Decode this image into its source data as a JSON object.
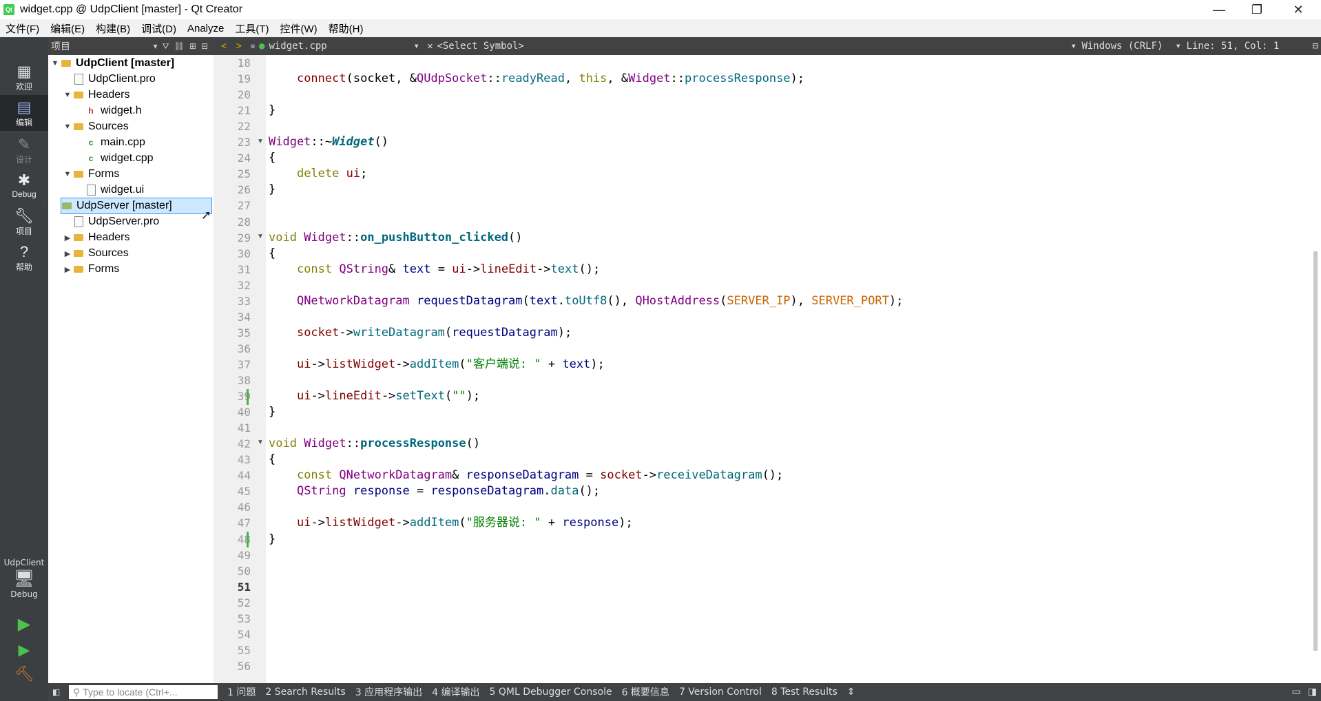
{
  "window": {
    "title": "widget.cpp @ UdpClient [master] - Qt Creator"
  },
  "menu": [
    "文件(F)",
    "编辑(E)",
    "构建(B)",
    "调试(D)",
    "Analyze",
    "工具(T)",
    "控件(W)",
    "帮助(H)"
  ],
  "modes": {
    "welcome": "欢迎",
    "edit": "编辑",
    "design": "设计",
    "debug": "Debug",
    "project": "项目",
    "help": "帮助"
  },
  "kit": {
    "project": "UdpClient",
    "config": "Debug"
  },
  "project_panel": {
    "title": "项目"
  },
  "tree": [
    {
      "label": "UdpClient [master]"
    },
    {
      "label": "UdpClient.pro"
    },
    {
      "label": "Headers"
    },
    {
      "label": "widget.h"
    },
    {
      "label": "Sources"
    },
    {
      "label": "main.cpp"
    },
    {
      "label": "widget.cpp"
    },
    {
      "label": "Forms"
    },
    {
      "label": "widget.ui"
    },
    {
      "label": "UdpServer [master]"
    },
    {
      "label": "UdpServer.pro"
    },
    {
      "label": "Headers"
    },
    {
      "label": "Sources"
    },
    {
      "label": "Forms"
    }
  ],
  "editor": {
    "file": "widget.cpp",
    "symbol": "<Select Symbol>",
    "line_ending": "Windows (CRLF)",
    "position": "Line: 51, Col: 1"
  },
  "line_numbers": [
    "18",
    "19",
    "20",
    "21",
    "22",
    "23",
    "24",
    "25",
    "26",
    "27",
    "28",
    "29",
    "30",
    "31",
    "32",
    "33",
    "34",
    "35",
    "36",
    "37",
    "38",
    "39",
    "40",
    "41",
    "42",
    "43",
    "44",
    "45",
    "46",
    "47",
    "48",
    "49",
    "50",
    "51",
    "52",
    "53",
    "54",
    "55",
    "56"
  ],
  "code": {
    "l19": [
      [
        "    ",
        ""
      ],
      [
        "connect",
        "#800000"
      ],
      [
        "(",
        "#000"
      ],
      [
        "socket",
        "#000"
      ],
      [
        ", &",
        "#000"
      ],
      [
        "QUdpSocket",
        "#800080"
      ],
      [
        "::",
        "#000"
      ],
      [
        "readyRead",
        "#00677c"
      ],
      [
        ", ",
        "#000"
      ],
      [
        "this",
        "#808000"
      ],
      [
        ", &",
        "#000"
      ],
      [
        "Widget",
        "#800080"
      ],
      [
        "::",
        "#000"
      ],
      [
        "processResponse",
        "#00677c"
      ],
      [
        ");",
        "#000"
      ]
    ],
    "l21": [
      [
        "}",
        "#000"
      ]
    ],
    "l23": [
      [
        "Widget",
        "#800080"
      ],
      [
        "::~",
        "#000"
      ],
      [
        "Widget",
        "#00677c"
      ],
      [
        "()",
        "#000"
      ]
    ],
    "l24": [
      [
        "{",
        "#000"
      ]
    ],
    "l25": [
      [
        "    ",
        ""
      ],
      [
        "delete",
        "#808000"
      ],
      [
        " ",
        "#000"
      ],
      [
        "ui",
        "#800000"
      ],
      [
        ";",
        "#000"
      ]
    ],
    "l26": [
      [
        "}",
        "#000"
      ]
    ],
    "l29": [
      [
        "void",
        "#808000"
      ],
      [
        " ",
        "#000"
      ],
      [
        "Widget",
        "#800080"
      ],
      [
        "::",
        "#000"
      ],
      [
        "on_pushButton_clicked",
        "#00677c"
      ],
      [
        "()",
        "#000"
      ]
    ],
    "l30": [
      [
        "{",
        "#000"
      ]
    ],
    "l31": [
      [
        "    ",
        ""
      ],
      [
        "const",
        "#808000"
      ],
      [
        " ",
        "#000"
      ],
      [
        "QString",
        "#800080"
      ],
      [
        "& ",
        "#000"
      ],
      [
        "text",
        "#000080"
      ],
      [
        " = ",
        "#000"
      ],
      [
        "ui",
        "#800000"
      ],
      [
        "->",
        "#000"
      ],
      [
        "lineEdit",
        "#800000"
      ],
      [
        "->",
        "#000"
      ],
      [
        "text",
        "#00677c"
      ],
      [
        "();",
        "#000"
      ]
    ],
    "l33": [
      [
        "    ",
        ""
      ],
      [
        "QNetworkDatagram",
        "#800080"
      ],
      [
        " ",
        "#000"
      ],
      [
        "requestDatagram",
        "#000080"
      ],
      [
        "(",
        "#000"
      ],
      [
        "text",
        "#000080"
      ],
      [
        ".",
        "#000"
      ],
      [
        "toUtf8",
        "#00677c"
      ],
      [
        "(), ",
        "#000"
      ],
      [
        "QHostAddress",
        "#800080"
      ],
      [
        "(",
        "#000"
      ],
      [
        "SERVER_IP",
        "#c86400"
      ],
      [
        "), ",
        "#000"
      ],
      [
        "SERVER_PORT",
        "#c86400"
      ],
      [
        ");",
        "#000"
      ]
    ],
    "l35": [
      [
        "    ",
        ""
      ],
      [
        "socket",
        "#800000"
      ],
      [
        "->",
        "#000"
      ],
      [
        "writeDatagram",
        "#00677c"
      ],
      [
        "(",
        "#000"
      ],
      [
        "requestDatagram",
        "#000080"
      ],
      [
        ");",
        "#000"
      ]
    ],
    "l37": [
      [
        "    ",
        ""
      ],
      [
        "ui",
        "#800000"
      ],
      [
        "->",
        "#000"
      ],
      [
        "listWidget",
        "#800000"
      ],
      [
        "->",
        "#000"
      ],
      [
        "addItem",
        "#00677c"
      ],
      [
        "(",
        "#000"
      ],
      [
        "\"客户端说: \"",
        "#008000"
      ],
      [
        " + ",
        "#000"
      ],
      [
        "text",
        "#000080"
      ],
      [
        ");",
        "#000"
      ]
    ],
    "l39": [
      [
        "    ",
        ""
      ],
      [
        "ui",
        "#800000"
      ],
      [
        "->",
        "#000"
      ],
      [
        "lineEdit",
        "#800000"
      ],
      [
        "->",
        "#000"
      ],
      [
        "setText",
        "#00677c"
      ],
      [
        "(",
        "#000"
      ],
      [
        "\"\"",
        "#008000"
      ],
      [
        ");",
        "#000"
      ]
    ],
    "l40": [
      [
        "}",
        "#000"
      ]
    ],
    "l42": [
      [
        "void",
        "#808000"
      ],
      [
        " ",
        "#000"
      ],
      [
        "Widget",
        "#800080"
      ],
      [
        "::",
        "#000"
      ],
      [
        "processResponse",
        "#00677c"
      ],
      [
        "()",
        "#000"
      ]
    ],
    "l43": [
      [
        "{",
        "#000"
      ]
    ],
    "l44": [
      [
        "    ",
        ""
      ],
      [
        "const",
        "#808000"
      ],
      [
        " ",
        "#000"
      ],
      [
        "QNetworkDatagram",
        "#800080"
      ],
      [
        "& ",
        "#000"
      ],
      [
        "responseDatagram",
        "#000080"
      ],
      [
        " = ",
        "#000"
      ],
      [
        "socket",
        "#800000"
      ],
      [
        "->",
        "#000"
      ],
      [
        "receiveDatagram",
        "#00677c"
      ],
      [
        "();",
        "#000"
      ]
    ],
    "l45": [
      [
        "    ",
        ""
      ],
      [
        "QString",
        "#800080"
      ],
      [
        " ",
        "#000"
      ],
      [
        "response",
        "#000080"
      ],
      [
        " = ",
        "#000"
      ],
      [
        "responseDatagram",
        "#000080"
      ],
      [
        ".",
        "#000"
      ],
      [
        "data",
        "#00677c"
      ],
      [
        "();",
        "#000"
      ]
    ],
    "l47": [
      [
        "    ",
        ""
      ],
      [
        "ui",
        "#800000"
      ],
      [
        "->",
        "#000"
      ],
      [
        "listWidget",
        "#800000"
      ],
      [
        "->",
        "#000"
      ],
      [
        "addItem",
        "#00677c"
      ],
      [
        "(",
        "#000"
      ],
      [
        "\"服务器说: \"",
        "#008000"
      ],
      [
        " + ",
        "#000"
      ],
      [
        "response",
        "#000080"
      ],
      [
        ");",
        "#000"
      ]
    ],
    "l48": [
      [
        "}",
        "#000"
      ]
    ]
  },
  "status": {
    "locate_placeholder": "Type to locate (Ctrl+...",
    "tabs": [
      "1 问题",
      "2 Search Results",
      "3 应用程序输出",
      "4 编译输出",
      "5 QML Debugger Console",
      "6 概要信息",
      "7 Version Control",
      "8 Test Results"
    ]
  }
}
